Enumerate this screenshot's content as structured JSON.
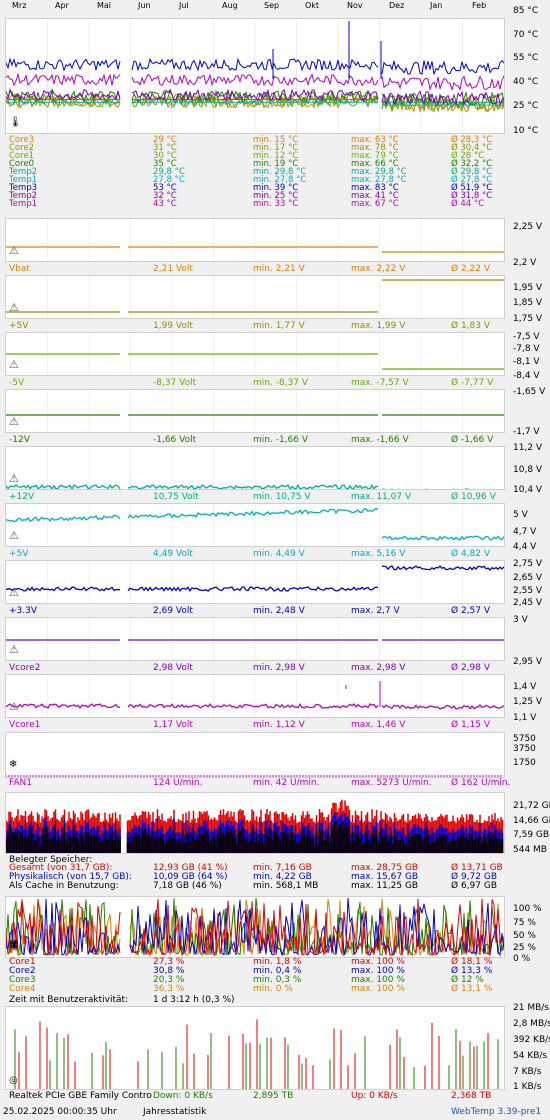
{
  "months": [
    "Mrz",
    "Apr",
    "Mai",
    "Jun",
    "Jul",
    "Aug",
    "Sep",
    "Okt",
    "Nov",
    "Dez",
    "Jan",
    "Feb"
  ],
  "temp": {
    "axis": [
      "85 °C",
      "70 °C",
      "55 °C",
      "40 °C",
      "25 °C",
      "10 °C"
    ],
    "rows": [
      {
        "name": "Core3",
        "cur": "29 °C",
        "min": "min. 15 °C",
        "max": "max. 63 °C",
        "avg": "Ø 28,3 °C",
        "color": "#e08000"
      },
      {
        "name": "Core2",
        "cur": "31 °C",
        "min": "min. 17 °C",
        "max": "max. 78 °C",
        "avg": "Ø 30,4 °C",
        "color": "#909000"
      },
      {
        "name": "Core1",
        "cur": "30 °C",
        "min": "min. 12 °C",
        "max": "max. 79 °C",
        "avg": "Ø 28 °C",
        "color": "#60b000"
      },
      {
        "name": "Core0",
        "cur": "35 °C",
        "min": "min. 19 °C",
        "max": "max. 66 °C",
        "avg": "Ø 32,2 °C",
        "color": "#208000"
      },
      {
        "name": "Temp2",
        "cur": "29,8 °C",
        "min": "min. 29,8 °C",
        "max": "max. 29,8 °C",
        "avg": "Ø 29,8 °C",
        "color": "#00b080"
      },
      {
        "name": "Temp1",
        "cur": "27,8 °C",
        "min": "min. 27,8 °C",
        "max": "max. 27,8 °C",
        "avg": "Ø 27,8 °C",
        "color": "#00b0c0"
      },
      {
        "name": "Temp3",
        "cur": "53 °C",
        "min": "min. 39 °C",
        "max": "max. 83 °C",
        "avg": "Ø 51,9 °C",
        "color": "#0000d0"
      },
      {
        "name": "Temp2",
        "cur": "32 °C",
        "min": "min. 25 °C",
        "max": "max. 41 °C",
        "avg": "Ø 31,8 °C",
        "color": "#8000c0"
      },
      {
        "name": "Temp1",
        "cur": "43 °C",
        "min": "min. 33 °C",
        "max": "max. 67 °C",
        "avg": "Ø 44 °C",
        "color": "#c000c0"
      }
    ]
  },
  "volt": [
    {
      "name": "Vbat",
      "cur": "2,21 Volt",
      "min": "min. 2,21 V",
      "max": "max. 2,22 V",
      "avg": "Ø 2,22 V",
      "color": "#e08000",
      "axis": [
        "2,25 V",
        "2,2 V"
      ]
    },
    {
      "name": "+5V",
      "cur": "1,99 Volt",
      "min": "min. 1,77 V",
      "max": "max. 1,99 V",
      "avg": "Ø 1,83 V",
      "color": "#909000",
      "axis": [
        "1,95 V",
        "1,85 V",
        "1,75 V"
      ]
    },
    {
      "name": "-5V",
      "cur": "-8,37 Volt",
      "min": "min. -8,37 V",
      "max": "max. -7,57 V",
      "avg": "Ø -7,77 V",
      "color": "#60b000",
      "axis": [
        "-7,5 V",
        "-7,8 V",
        "-8,1 V",
        "-8,4 V"
      ]
    },
    {
      "name": "-12V",
      "cur": "-1,66 Volt",
      "min": "min. -1,66 V",
      "max": "max. -1,66 V",
      "avg": "Ø -1,66 V",
      "color": "#208000",
      "axis": [
        "-1,65 V",
        "-1,7 V"
      ]
    },
    {
      "name": "+12V",
      "cur": "10,75 Volt",
      "min": "min. 10,75 V",
      "max": "max. 11,07 V",
      "avg": "Ø 10,96 V",
      "color": "#00b080",
      "axis": [
        "11,2 V",
        "10,8 V",
        "10,4 V"
      ]
    },
    {
      "name": "+5V",
      "cur": "4,49 Volt",
      "min": "min. 4,49 V",
      "max": "max. 5,16 V",
      "avg": "Ø 4,82 V",
      "color": "#00b0c0",
      "axis": [
        "5 V",
        "4,7 V",
        "4,4 V"
      ]
    },
    {
      "name": "+3.3V",
      "cur": "2,69 Volt",
      "min": "min. 2,48 V",
      "max": "max. 2,7 V",
      "avg": "Ø 2,57 V",
      "color": "#0000d0",
      "axis": [
        "2,75 V",
        "2,65 V",
        "2,55 V",
        "2,45 V"
      ]
    },
    {
      "name": "Vcore2",
      "cur": "2,98 Volt",
      "min": "min. 2,98 V",
      "max": "max. 2,98 V",
      "avg": "Ø 2,98 V",
      "color": "#8000c0",
      "axis": [
        "3 V",
        "2,95 V"
      ]
    },
    {
      "name": "Vcore1",
      "cur": "1,17 Volt",
      "min": "min. 1,12 V",
      "max": "max. 1,46 V",
      "avg": "Ø 1,15 V",
      "color": "#c000c0",
      "axis": [
        "1,4 V",
        "1,25 V",
        "1,1 V"
      ]
    }
  ],
  "fan": {
    "name": "FAN1",
    "cur": "124 U/min.",
    "min": "min. 42 U/min.",
    "max": "max. 5273 U/min.",
    "avg": "Ø 162 U/min.",
    "color": "#c000c0",
    "axis": [
      "5750",
      "3750",
      "1750"
    ]
  },
  "mem": {
    "axis": [
      "21,72 GB",
      "14,66 GB",
      "7,59 GB",
      "544 MB"
    ],
    "header": "Belegter Speicher:",
    "rows": [
      {
        "name": "Gesamt (von 31,7 GB):",
        "cur": "12,93 GB (41 %)",
        "min": "min. 7,16 GB",
        "max": "max. 28,75 GB",
        "avg": "Ø 13,71 GB",
        "color": "#e00000"
      },
      {
        "name": "Physikalisch (von 15,7 GB):",
        "cur": "10,09 GB (64 %)",
        "min": "min. 4,22 GB",
        "max": "max. 15,67 GB",
        "avg": "Ø 9,72 GB",
        "color": "#0000d0"
      },
      {
        "name": "Als Cache in Benutzung:",
        "cur": "7,18 GB (46 %)",
        "min": "min. 568,1 MB",
        "max": "max. 11,25 GB",
        "avg": "Ø 6,97 GB",
        "color": "#000000"
      }
    ]
  },
  "cpu": {
    "axis": [
      "100 %",
      "75 %",
      "50 %",
      "25 %",
      "0 %"
    ],
    "rows": [
      {
        "name": "Core1",
        "cur": "27,3 %",
        "min": "min. 1,8 %",
        "max": "max. 100 %",
        "avg": "Ø 18,1 %",
        "color": "#e00000"
      },
      {
        "name": "Core2",
        "cur": "30,8 %",
        "min": "min. 0,4 %",
        "max": "max. 100 %",
        "avg": "Ø 13,3 %",
        "color": "#0000d0"
      },
      {
        "name": "Core3",
        "cur": "20,3 %",
        "min": "min. 0,3 %",
        "max": "max. 100 %",
        "avg": "Ø 12 %",
        "color": "#208000"
      },
      {
        "name": "Core4",
        "cur": "36,3 %",
        "min": "min. 0 %",
        "max": "max. 100 %",
        "avg": "Ø 13,1 %",
        "color": "#e08000"
      }
    ],
    "activity": "Zeit mit Benutzeraktivität:",
    "activity_val": "1 d 3:12 h (0,3 %)"
  },
  "net": {
    "axis": [
      "21 MB/s",
      "2,8 MB/s",
      "392 KB/s",
      "54 KB/s",
      "7 KB/s",
      "1 KB/s"
    ],
    "name": "Realtek PCIe GBE Family Contro",
    "down": "Down: 0 KB/s",
    "down_total": "2,895 TB",
    "up": "Up: 0 KB/s",
    "up_total": "2,368 TB"
  },
  "footer": {
    "datetime": "25.02.2025 00:00:35 Uhr",
    "period": "Jahresstatistik",
    "version": "WebTemp 3.39-pre1"
  }
}
